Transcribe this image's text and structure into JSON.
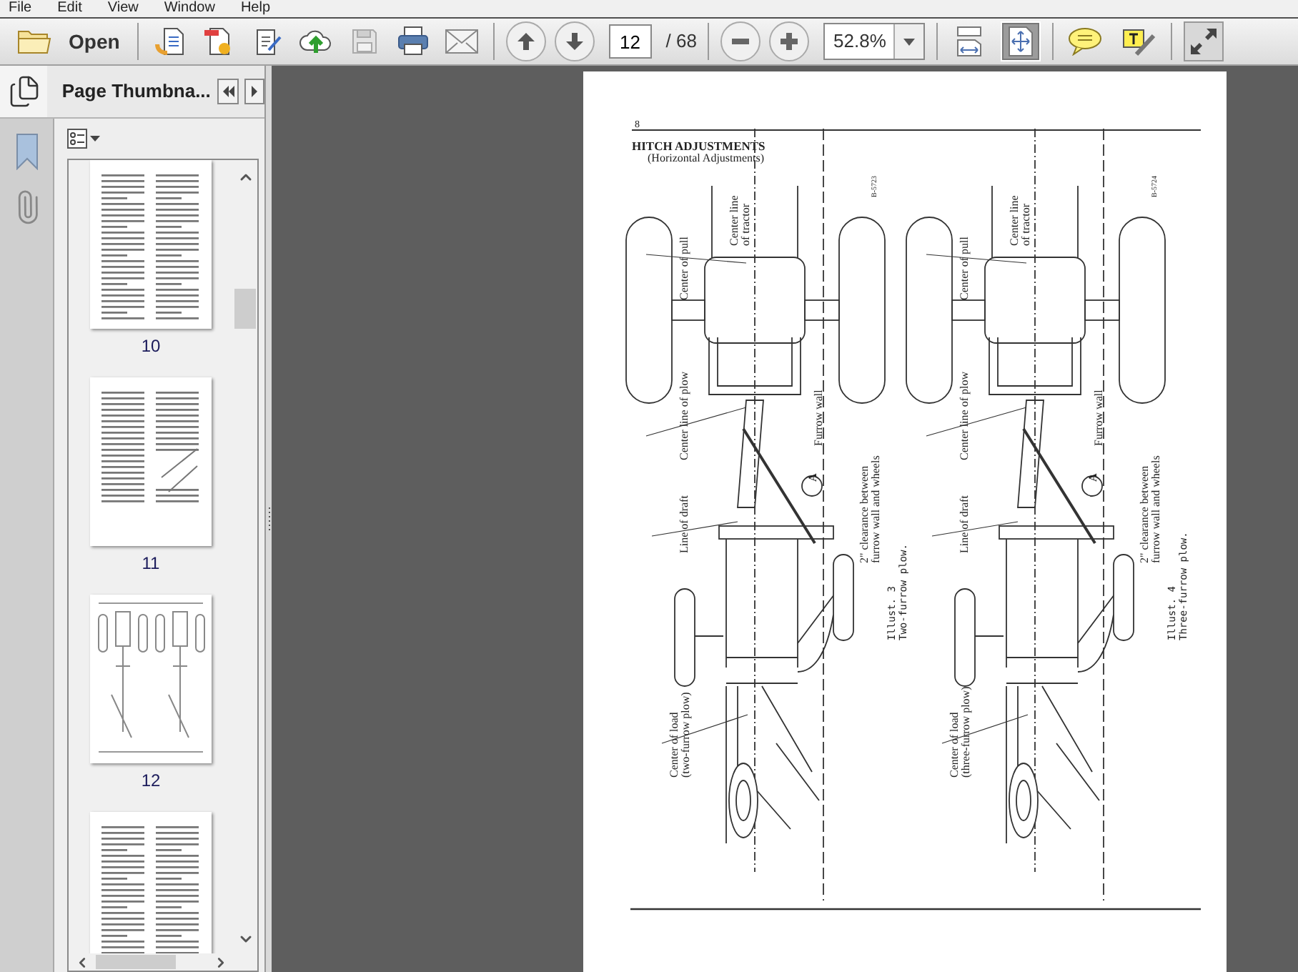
{
  "menu": [
    "File",
    "Edit",
    "View",
    "Window",
    "Help"
  ],
  "toolbar": {
    "open_label": "Open",
    "page_number": "12",
    "page_total": "/ 68",
    "zoom": "52.8%",
    "view_modes": [
      {
        "kind": "fit-width",
        "selected": false
      },
      {
        "kind": "fit-page",
        "selected": true
      }
    ]
  },
  "panel": {
    "title": "Page Thumbna...",
    "thumbnails": [
      {
        "label": "10",
        "kind": "text"
      },
      {
        "label": "11",
        "kind": "figure-text"
      },
      {
        "label": "12",
        "kind": "diagram"
      },
      {
        "kind": "text"
      }
    ]
  },
  "page": {
    "number": "8",
    "heading": "HITCH ADJUSTMENTS",
    "subheading": "(Horizontal Adjustments)",
    "illustrations": [
      {
        "code": "B-5723",
        "labels": {
          "center_line_tractor": [
            "Center line",
            "of tractor"
          ],
          "center_of_pull": "Center of pull",
          "center_line_plow": "Center line of plow",
          "furrow_wall": "Furrow wall",
          "line_of_draft": "Line of draft",
          "clearance": [
            "2\" clearance between",
            "furrow wall and wheels"
          ],
          "marker": "A",
          "caption": [
            "Illust. 3",
            "Two-furrow plow."
          ],
          "center_of_load": [
            "Center of load",
            "(two-furrow plow)"
          ]
        }
      },
      {
        "code": "B-5724",
        "labels": {
          "center_line_tractor": [
            "Center line",
            "of tractor"
          ],
          "center_of_pull": "Center of pull",
          "center_line_plow": "Center line of plow",
          "furrow_wall": "Furrow wall",
          "line_of_draft": "Line of draft",
          "clearance": [
            "2\" clearance between",
            "furrow wall and wheels"
          ],
          "marker": "A",
          "caption": [
            "Illust. 4",
            "Three-furrow plow."
          ],
          "center_of_load": [
            "Center of load",
            "(three-furrow plow)"
          ]
        }
      }
    ]
  }
}
